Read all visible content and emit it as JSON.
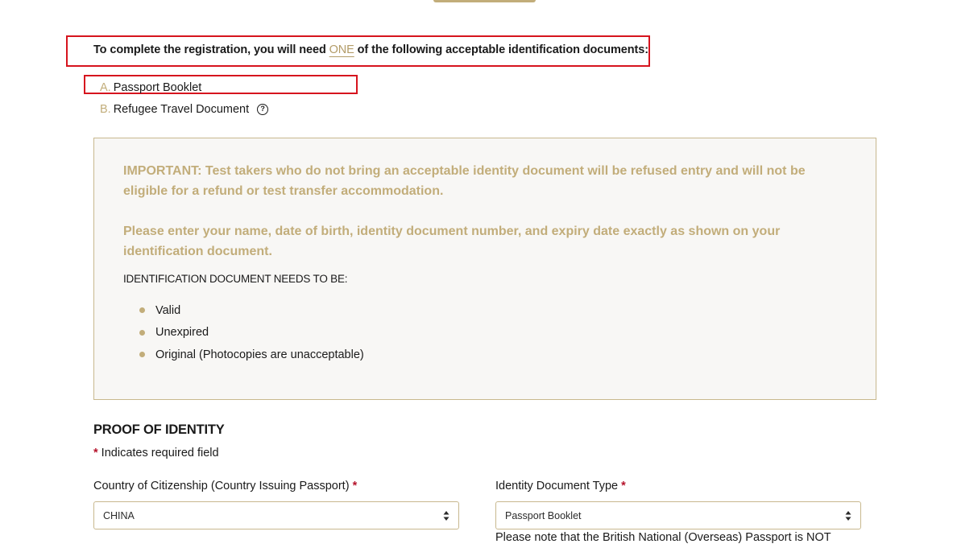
{
  "intro": {
    "before": "To complete the registration, you will need ",
    "emphasis": "ONE",
    "after": " of the following acceptable identification documents:"
  },
  "documents": [
    {
      "letter": "A.",
      "label": "Passport Booklet"
    },
    {
      "letter": "B.",
      "label": "Refugee Travel Document",
      "help_icon": "question-circle-icon"
    }
  ],
  "notice": {
    "important": "IMPORTANT: Test takers who do not bring an acceptable identity document will be refused entry and will not be eligible for a refund or test transfer accommodation.",
    "instruction": "Please enter your name, date of birth, identity document number, and expiry date exactly as shown on your identification document.",
    "needs_heading": "IDENTIFICATION DOCUMENT NEEDS TO BE:",
    "requirements": [
      "Valid",
      "Unexpired",
      "Original (Photocopies are unacceptable)"
    ]
  },
  "proof": {
    "title": "PROOF OF IDENTITY",
    "required_symbol": "*",
    "required_note": " Indicates required field",
    "country_label": "Country of Citizenship (Country Issuing Passport)",
    "country_value": "CHINA",
    "idtype_label": "Identity Document Type",
    "idtype_value": "Passport Booklet",
    "idtype_help": "Please note that the British National (Overseas) Passport is NOT"
  },
  "colors": {
    "accent_gold": "#c2ad7a",
    "highlight_red": "#d6141e",
    "required_red": "#b5132b"
  }
}
